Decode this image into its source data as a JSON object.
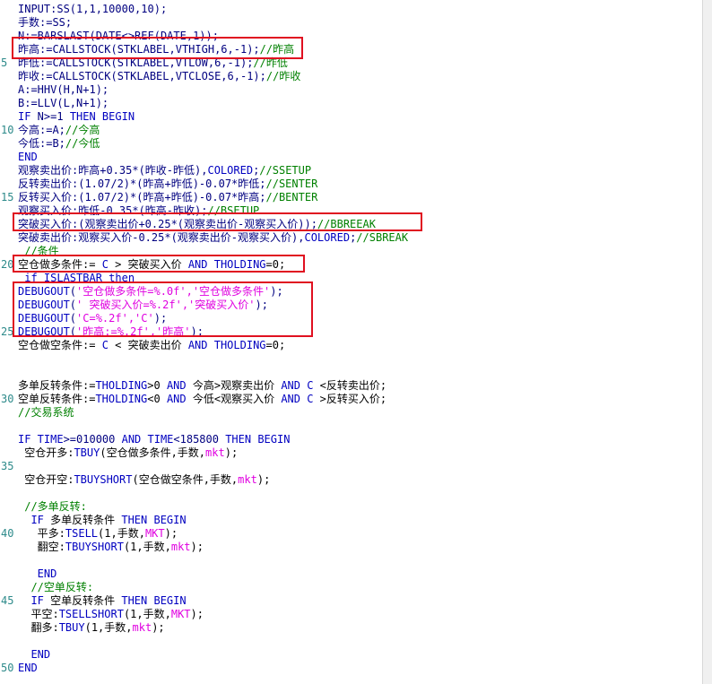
{
  "editor": {
    "lines": [
      {
        "num": "",
        "segs": [
          [
            "t-plain",
            "INPUT:SS(1,1,10000,10);"
          ]
        ]
      },
      {
        "num": "",
        "segs": [
          [
            "t-plain",
            "手数:=SS;"
          ]
        ]
      },
      {
        "num": "",
        "segs": [
          [
            "t-plain",
            "N:=BARSLAST(DATE<>REF(DATE,1));"
          ]
        ]
      },
      {
        "num": "",
        "segs": [
          [
            "t-plain",
            "昨高:=CALLSTOCK(STKLABEL,VTHIGH,6,-1);"
          ],
          [
            "t-cm",
            "//昨高"
          ]
        ]
      },
      {
        "num": "5",
        "segs": [
          [
            "t-plain",
            "昨低:=CALLSTOCK(STKLABEL,VTLOW,6,-1);"
          ],
          [
            "t-cm",
            "//昨低"
          ]
        ]
      },
      {
        "num": "",
        "segs": [
          [
            "t-plain",
            "昨收:=CALLSTOCK(STKLABEL,VTCLOSE,6,-1);"
          ],
          [
            "t-cm",
            "//昨收"
          ]
        ]
      },
      {
        "num": "",
        "segs": [
          [
            "t-plain",
            "A:=HHV(H,N+1);"
          ]
        ]
      },
      {
        "num": "",
        "segs": [
          [
            "t-plain",
            "B:=LLV(L,N+1);"
          ]
        ]
      },
      {
        "num": "",
        "segs": [
          [
            "t-fn",
            "IF"
          ],
          [
            "t-plain",
            " N>=1 "
          ],
          [
            "t-fn",
            "THEN BEGIN"
          ]
        ]
      },
      {
        "num": "10",
        "segs": [
          [
            "t-plain",
            "今高:=A;"
          ],
          [
            "t-cm",
            "//今高"
          ]
        ]
      },
      {
        "num": "",
        "segs": [
          [
            "t-plain",
            "今低:=B;"
          ],
          [
            "t-cm",
            "//今低"
          ]
        ]
      },
      {
        "num": "",
        "segs": [
          [
            "t-fn",
            "END"
          ]
        ]
      },
      {
        "num": "",
        "segs": [
          [
            "t-plain",
            "观察卖出价:昨高+0.35*(昨收-昨低),"
          ],
          [
            "t-fn",
            "COLORED"
          ],
          [
            "t-plain",
            ";"
          ],
          [
            "t-cm",
            "//SSETUP"
          ]
        ]
      },
      {
        "num": "",
        "segs": [
          [
            "t-plain",
            "反转卖出价:(1.07/2)*(昨高+昨低)-0.07*昨低;"
          ],
          [
            "t-cm",
            "//SENTER"
          ]
        ]
      },
      {
        "num": "15",
        "segs": [
          [
            "t-plain",
            "反转买入价:(1.07/2)*(昨高+昨低)-0.07*昨高;"
          ],
          [
            "t-cm",
            "//BENTER"
          ]
        ]
      },
      {
        "num": "",
        "segs": [
          [
            "t-plain",
            "观察买入价:昨低-0.35*(昨高-昨收);"
          ],
          [
            "t-cm",
            "//BSETUP"
          ]
        ]
      },
      {
        "num": "",
        "segs": [
          [
            "t-plain",
            "突破买入价:(观察卖出价+0.25*(观察卖出价-观察买入价));"
          ],
          [
            "t-cm",
            "//BBREEAK"
          ]
        ]
      },
      {
        "num": "",
        "segs": [
          [
            "t-plain",
            "突破卖出价:观察买入价-0.25*(观察卖出价-观察买入价),"
          ],
          [
            "t-fn",
            "COLORED"
          ],
          [
            "t-plain",
            ";"
          ],
          [
            "t-cm",
            "//SBREAK"
          ]
        ]
      },
      {
        "num": "",
        "segs": [
          [
            "t-cm",
            " //条件"
          ]
        ]
      },
      {
        "num": "20",
        "segs": [
          [
            "t-black",
            "空仓做多条件:= "
          ],
          [
            "t-fn",
            "C"
          ],
          [
            "t-black",
            " > 突破买入价 "
          ],
          [
            "t-fn",
            "AND THOLDING"
          ],
          [
            "t-black",
            "=0;"
          ]
        ]
      },
      {
        "num": "",
        "segs": [
          [
            "t-plain",
            " "
          ],
          [
            "t-fn",
            "if ISLASTBAR then"
          ]
        ]
      },
      {
        "num": "",
        "segs": [
          [
            "t-fn",
            "DEBUGOUT"
          ],
          [
            "t-plain",
            "("
          ],
          [
            "t-str",
            "'空仓做多条件=%.0f','空仓做多条件'"
          ],
          [
            "t-plain",
            ");"
          ]
        ]
      },
      {
        "num": "",
        "segs": [
          [
            "t-fn",
            "DEBUGOUT"
          ],
          [
            "t-plain",
            "("
          ],
          [
            "t-str",
            "' 突破买入价=%.2f','突破买入价'"
          ],
          [
            "t-plain",
            ");"
          ]
        ]
      },
      {
        "num": "",
        "segs": [
          [
            "t-fn",
            "DEBUGOUT"
          ],
          [
            "t-plain",
            "("
          ],
          [
            "t-str",
            "'C=%.2f','C'"
          ],
          [
            "t-plain",
            ");"
          ]
        ]
      },
      {
        "num": "25",
        "segs": [
          [
            "t-fn",
            "DEBUGOUT"
          ],
          [
            "t-plain",
            "("
          ],
          [
            "t-str",
            "'昨高:=%.2f','昨高'"
          ],
          [
            "t-plain",
            ");"
          ]
        ]
      },
      {
        "num": "",
        "segs": [
          [
            "t-black",
            "空仓做空条件:= "
          ],
          [
            "t-fn",
            "C"
          ],
          [
            "t-black",
            " < 突破卖出价 "
          ],
          [
            "t-fn",
            "AND THOLDING"
          ],
          [
            "t-black",
            "=0;"
          ]
        ]
      },
      {
        "num": "",
        "segs": []
      },
      {
        "num": "",
        "segs": []
      },
      {
        "num": "",
        "segs": [
          [
            "t-black",
            "多单反转条件:="
          ],
          [
            "t-fn",
            "THOLDING"
          ],
          [
            "t-black",
            ">0 "
          ],
          [
            "t-fn",
            "AND"
          ],
          [
            "t-black",
            " 今高>观察卖出价 "
          ],
          [
            "t-fn",
            "AND C"
          ],
          [
            "t-black",
            " <反转卖出价;"
          ]
        ]
      },
      {
        "num": "30",
        "segs": [
          [
            "t-black",
            "空单反转条件:="
          ],
          [
            "t-fn",
            "THOLDING"
          ],
          [
            "t-black",
            "<0 "
          ],
          [
            "t-fn",
            "AND"
          ],
          [
            "t-black",
            " 今低<观察买入价 "
          ],
          [
            "t-fn",
            "AND C"
          ],
          [
            "t-black",
            " >反转买入价;"
          ]
        ]
      },
      {
        "num": "",
        "segs": [
          [
            "t-cm",
            "//交易系统"
          ]
        ]
      },
      {
        "num": "",
        "segs": []
      },
      {
        "num": "",
        "segs": [
          [
            "t-fn",
            "IF TIME"
          ],
          [
            "t-plain",
            ">=010000 "
          ],
          [
            "t-fn",
            "AND TIME"
          ],
          [
            "t-plain",
            "<185800 "
          ],
          [
            "t-fn",
            "THEN BEGIN"
          ]
        ]
      },
      {
        "num": "",
        "segs": [
          [
            "t-black",
            " 空仓开多:"
          ],
          [
            "t-fn",
            "TBUY"
          ],
          [
            "t-black",
            "(空仓做多条件,手数,"
          ],
          [
            "t-str",
            "mkt"
          ],
          [
            "t-black",
            ");"
          ]
        ]
      },
      {
        "num": "35",
        "segs": []
      },
      {
        "num": "",
        "segs": [
          [
            "t-black",
            " 空仓开空:"
          ],
          [
            "t-fn",
            "TBUYSHORT"
          ],
          [
            "t-black",
            "(空仓做空条件,手数,"
          ],
          [
            "t-str",
            "mkt"
          ],
          [
            "t-black",
            ");"
          ]
        ]
      },
      {
        "num": "",
        "segs": []
      },
      {
        "num": "",
        "segs": [
          [
            "t-cm",
            " //多单反转:"
          ]
        ]
      },
      {
        "num": "",
        "segs": [
          [
            "t-fn",
            "  IF"
          ],
          [
            "t-black",
            " 多单反转条件 "
          ],
          [
            "t-fn",
            "THEN BEGIN"
          ]
        ]
      },
      {
        "num": "40",
        "segs": [
          [
            "t-black",
            "   平多:"
          ],
          [
            "t-fn",
            "TSELL"
          ],
          [
            "t-black",
            "(1,手数,"
          ],
          [
            "t-str",
            "MKT"
          ],
          [
            "t-black",
            ");"
          ]
        ]
      },
      {
        "num": "",
        "segs": [
          [
            "t-black",
            "   翻空:"
          ],
          [
            "t-fn",
            "TBUYSHORT"
          ],
          [
            "t-black",
            "(1,手数,"
          ],
          [
            "t-str",
            "mkt"
          ],
          [
            "t-black",
            ");"
          ]
        ]
      },
      {
        "num": "",
        "segs": []
      },
      {
        "num": "",
        "segs": [
          [
            "t-fn",
            "   END"
          ]
        ]
      },
      {
        "num": "",
        "segs": [
          [
            "t-cm",
            "  //空单反转:"
          ]
        ]
      },
      {
        "num": "45",
        "segs": [
          [
            "t-fn",
            "  IF"
          ],
          [
            "t-black",
            " 空单反转条件 "
          ],
          [
            "t-fn",
            "THEN BEGIN"
          ]
        ]
      },
      {
        "num": "",
        "segs": [
          [
            "t-black",
            "  平空:"
          ],
          [
            "t-fn",
            "TSELLSHORT"
          ],
          [
            "t-black",
            "(1,手数,"
          ],
          [
            "t-str",
            "MKT"
          ],
          [
            "t-black",
            ");"
          ]
        ]
      },
      {
        "num": "",
        "segs": [
          [
            "t-black",
            "  翻多:"
          ],
          [
            "t-fn",
            "TBUY"
          ],
          [
            "t-black",
            "(1,手数,"
          ],
          [
            "t-str",
            "mkt"
          ],
          [
            "t-black",
            ");"
          ]
        ]
      },
      {
        "num": "",
        "segs": []
      },
      {
        "num": "",
        "segs": [
          [
            "t-fn",
            "  END"
          ]
        ]
      },
      {
        "num": "50",
        "segs": [
          [
            "t-fn",
            "END"
          ]
        ]
      }
    ]
  },
  "colors": {
    "highlight_box": "#e01020",
    "keyword": "#0000c0",
    "comment": "#008000",
    "string": "#e000e0",
    "line_number": "#2d8a8a"
  }
}
